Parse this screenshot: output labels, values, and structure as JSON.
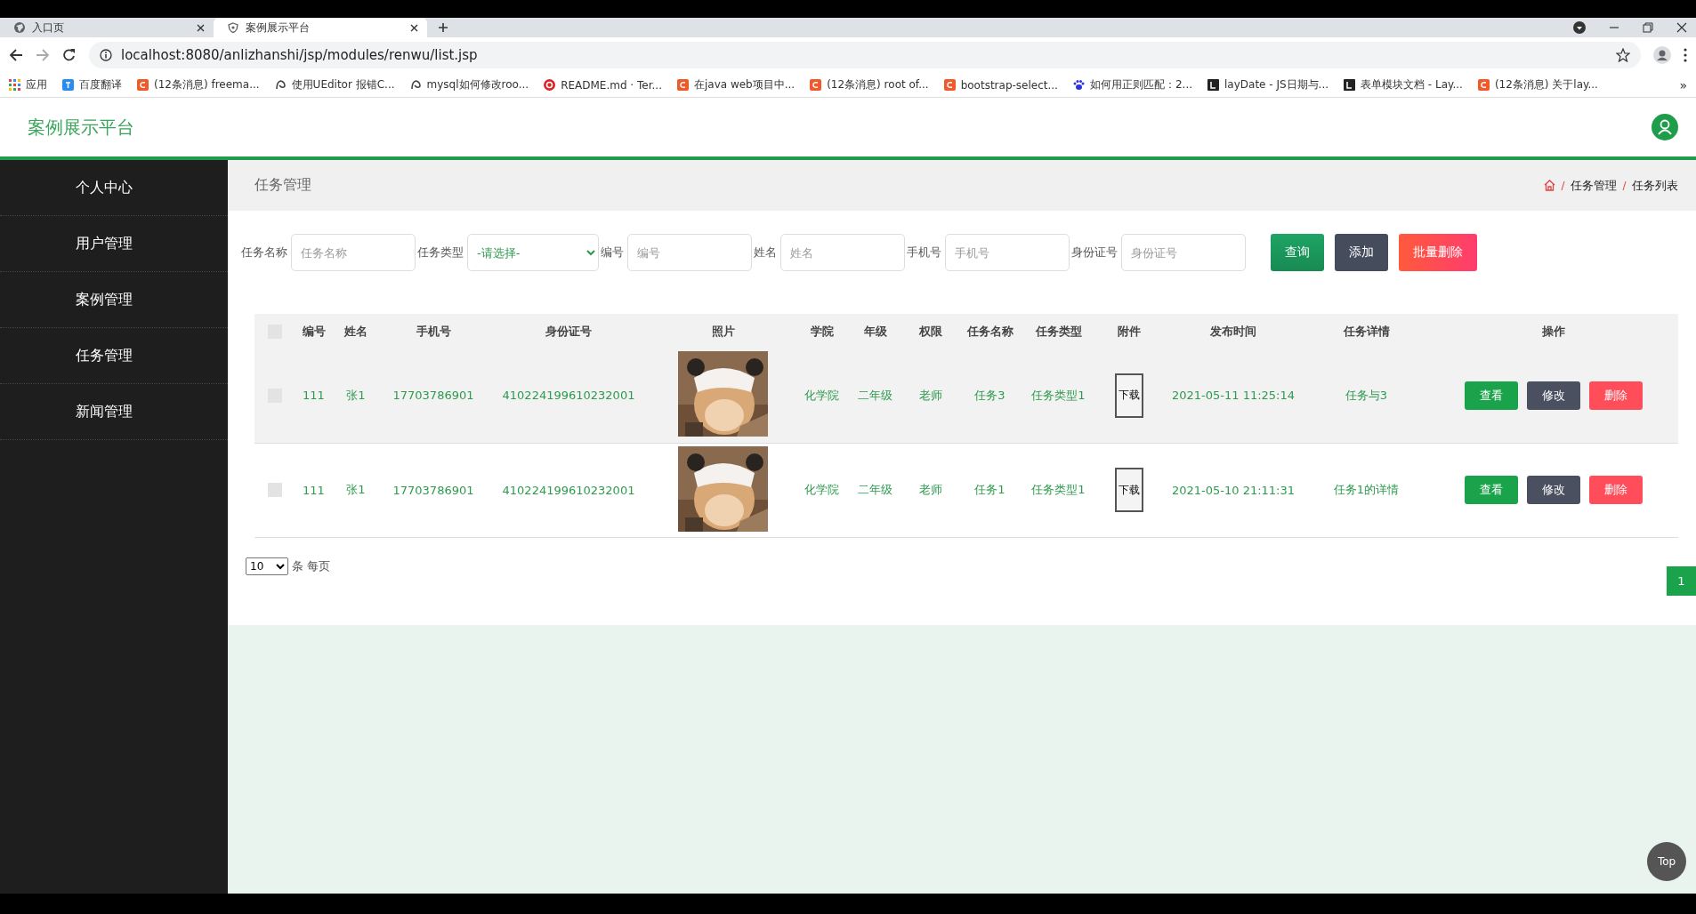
{
  "browser": {
    "tabs": [
      {
        "title": "入口页",
        "selected": false
      },
      {
        "title": "案例展示平台",
        "selected": true
      }
    ],
    "address": "localhost:8080/anlizhanshi/jsp/modules/renwu/list.jsp",
    "bookmarks": [
      {
        "title": "应用",
        "kind": "apps"
      },
      {
        "title": "百度翻译",
        "kind": "blue"
      },
      {
        "title": "(12条消息) freema...",
        "kind": "red"
      },
      {
        "title": "使用UEditor 报错C...",
        "kind": "grey"
      },
      {
        "title": "mysql如何修改roo...",
        "kind": "grey"
      },
      {
        "title": "README.md · Ter...",
        "kind": "round"
      },
      {
        "title": "在java web项目中...",
        "kind": "red"
      },
      {
        "title": "(12条消息) root of...",
        "kind": "red"
      },
      {
        "title": "bootstrap-select...",
        "kind": "red"
      },
      {
        "title": "如何用正则匹配：2...",
        "kind": "paw"
      },
      {
        "title": "layDate - JS日期与...",
        "kind": "dark"
      },
      {
        "title": "表单模块文档 - Lay...",
        "kind": "dark"
      },
      {
        "title": "(12条消息) 关于lay...",
        "kind": "red"
      }
    ],
    "more": "»"
  },
  "header": {
    "title": "案例展示平台"
  },
  "sidebar": {
    "items": [
      {
        "label": "个人中心",
        "selected": false
      },
      {
        "label": "用户管理",
        "selected": false
      },
      {
        "label": "案例管理",
        "selected": false
      },
      {
        "label": "任务管理",
        "selected": false
      },
      {
        "label": "新闻管理",
        "selected": false
      }
    ]
  },
  "page_title": "任务管理",
  "breadcrumb": [
    "任务管理",
    "任务列表"
  ],
  "filters": [
    {
      "label": "任务名称",
      "kind": "input",
      "placeholder": "任务名称"
    },
    {
      "label": "任务类型",
      "kind": "select",
      "value": "-请选择-"
    },
    {
      "label": "编号",
      "kind": "input",
      "placeholder": "编号"
    },
    {
      "label": "姓名",
      "kind": "input",
      "placeholder": "姓名"
    },
    {
      "label": "手机号",
      "kind": "input",
      "placeholder": "手机号"
    },
    {
      "label": "身份证号",
      "kind": "input",
      "placeholder": "身份证号"
    }
  ],
  "filter_buttons": [
    {
      "label": "查询",
      "kind": "search"
    },
    {
      "label": "添加",
      "kind": "add"
    },
    {
      "label": "批量删除",
      "kind": "delete"
    }
  ],
  "table": {
    "select_all_checked": false,
    "columns": [
      "编号",
      "姓名",
      "手机号",
      "身份证号",
      "照片",
      "学院",
      "年级",
      "权限",
      "任务名称",
      "任务类型",
      "附件",
      "发布时间",
      "任务详情",
      "操作"
    ],
    "rows": [
      {
        "checked": false,
        "hovered": true,
        "cells": [
          "111",
          "张1",
          "17703786901",
          "410224199610232001",
          {
            "kind": "picture"
          },
          "化学院",
          "二年级",
          "老师",
          "任务3",
          "任务类型1",
          {
            "kind": "button",
            "label": "下载"
          },
          "2021-05-11 11:25:14",
          "任务与3",
          {
            "kind": "actions",
            "buttons": [
              {
                "label": "查看",
                "kind": "view"
              },
              {
                "label": "修改",
                "kind": "edit"
              },
              {
                "label": "删除",
                "kind": "delete"
              }
            ]
          }
        ]
      },
      {
        "checked": false,
        "hovered": false,
        "cells": [
          "111",
          "张1",
          "17703786901",
          "410224199610232001",
          {
            "kind": "picture"
          },
          "化学院",
          "二年级",
          "老师",
          "任务1",
          "任务类型1",
          {
            "kind": "button",
            "label": "下载"
          },
          "2021-05-10 21:11:31",
          "任务1的详情",
          {
            "kind": "actions",
            "buttons": [
              {
                "label": "查看",
                "kind": "view"
              },
              {
                "label": "修改",
                "kind": "edit"
              },
              {
                "label": "删除",
                "kind": "delete"
              }
            ]
          }
        ]
      }
    ]
  },
  "page_size": {
    "value": "10",
    "label": "条 每页"
  },
  "pagination": [
    {
      "label": "1",
      "selected": true
    }
  ],
  "top_button": "Top"
}
